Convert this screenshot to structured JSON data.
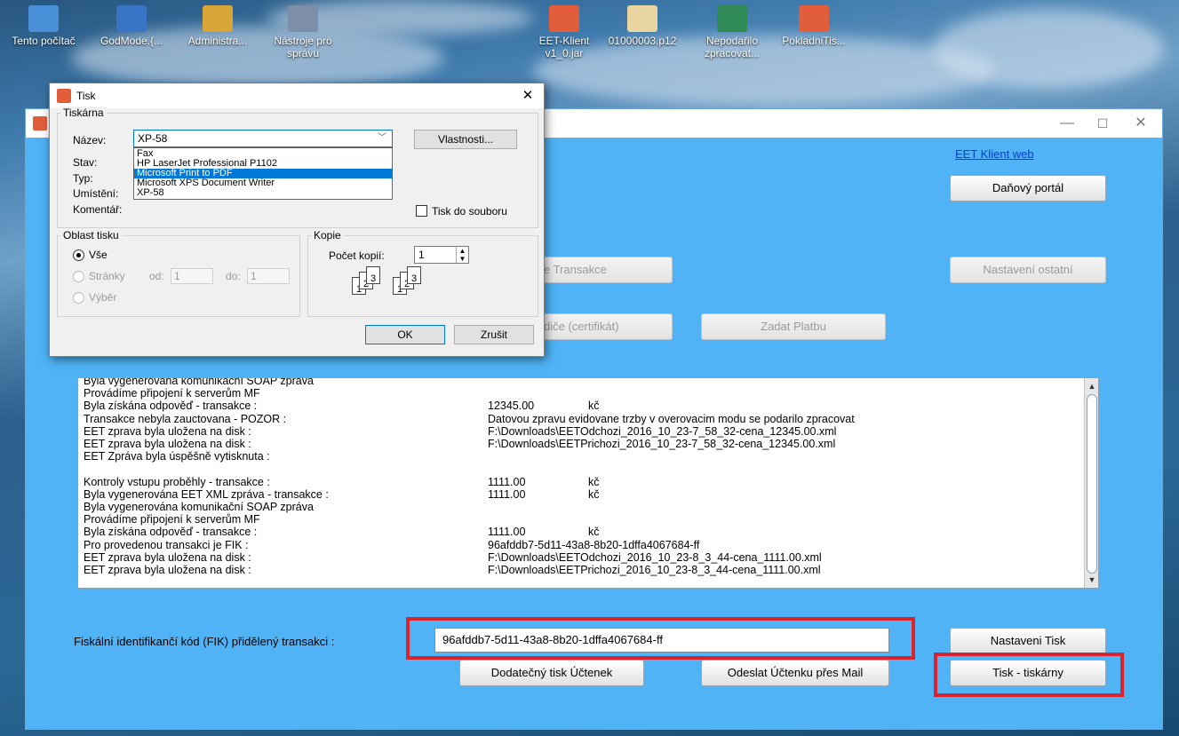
{
  "desktop": {
    "icons": [
      {
        "label": "Tento počítač",
        "icon": "computer-icon",
        "color": "#4a90d9"
      },
      {
        "label": "GodMode.{...",
        "icon": "control-panel-icon",
        "color": "#3a74c4"
      },
      {
        "label": "Administra...",
        "icon": "user-folder-icon",
        "color": "#d8a638"
      },
      {
        "label": "Nástroje pro správu",
        "icon": "admin-tools-icon",
        "color": "#7d8fa8"
      },
      {
        "label": "EET-Klient v1_0.jar",
        "icon": "java-jar-icon",
        "color": "#e25d3a"
      },
      {
        "label": "01000003.p12",
        "icon": "certificate-icon",
        "color": "#e8d5a0"
      },
      {
        "label": "Nepodařilo zpracovat...",
        "icon": "publisher-icon",
        "color": "#2f8a55"
      },
      {
        "label": "PokladniTis...",
        "icon": "java-jar-icon",
        "color": "#e25d3a"
      }
    ]
  },
  "app": {
    "title": "",
    "eet_link": "EET Klient web",
    "buttons": {
      "danovy_portal": "Daňový portál",
      "transakce": "e Transakce",
      "nastaveni_ostatni": "Nastavení ostatní",
      "certifikat": "diče (certifikát)",
      "zadat_platbu": "Zadat Platbu",
      "nastaveni_tisk": "Nastaveni Tisk",
      "dodatecny_tisk": "Dodatečný tisk Účtenek",
      "odeslat_mail": "Odeslat Účtenku přes Mail",
      "tisk_tiskarny": "Tisk - tiskárny"
    },
    "log": [
      {
        "text": "Byla vygenerována komunikační SOAP zpráva",
        "value": "",
        "unit": ""
      },
      {
        "text": "Provádíme připojení k serverům MF",
        "value": "",
        "unit": ""
      },
      {
        "text": "Byla získána odpověď - transakce :",
        "value": "12345.00",
        "unit": "kč"
      },
      {
        "text": "Transakce nebyla zauctovana - POZOR :",
        "value": "Datovou zpravu evidovane trzby v overovacim modu se podarilo zpracovat",
        "unit": ""
      },
      {
        "text": "EET zprava byla uložena na disk :",
        "value": "F:\\Downloads\\EETOdchozi_2016_10_23-7_58_32-cena_12345.00.xml",
        "unit": ""
      },
      {
        "text": "EET zprava byla uložena na disk :",
        "value": "F:\\Downloads\\EETPrichozi_2016_10_23-7_58_32-cena_12345.00.xml",
        "unit": ""
      },
      {
        "text": "EET Zpráva byla úspěšně vytisknuta :",
        "value": "",
        "unit": ""
      },
      {
        "text": "",
        "value": "",
        "unit": ""
      },
      {
        "text": "Kontroly vstupu proběhly - transakce :",
        "value": "1111.00",
        "unit": "kč"
      },
      {
        "text": "Byla vygenerována EET XML zpráva - transakce :",
        "value": "1111.00",
        "unit": "kč"
      },
      {
        "text": "Byla vygenerována komunikační SOAP zpráva",
        "value": "",
        "unit": ""
      },
      {
        "text": "Provádíme připojení k serverům MF",
        "value": "",
        "unit": ""
      },
      {
        "text": "Byla získána odpověď - transakce :",
        "value": "1111.00",
        "unit": "kč"
      },
      {
        "text": "Pro provedenou transakci je FIK :",
        "value": "96afddb7-5d11-43a8-8b20-1dffa4067684-ff",
        "unit": ""
      },
      {
        "text": "EET zprava byla uložena na disk :",
        "value": "F:\\Downloads\\EETOdchozi_2016_10_23-8_3_44-cena_1111.00.xml",
        "unit": ""
      },
      {
        "text": "EET zprava byla uložena na disk :",
        "value": "F:\\Downloads\\EETPrichozi_2016_10_23-8_3_44-cena_1111.00.xml",
        "unit": ""
      }
    ],
    "fik_label": "Fiskální identifikančí kód (FIK) přidělený transakci :",
    "fik_value": "96afddb7-5d11-43a8-8b20-1dffa4067684-ff",
    "highlight_color": "#d9232f",
    "background_color": "#4fb3f5"
  },
  "print_dialog": {
    "title": "Tisk",
    "printer_group": "Tiskárna",
    "name_label": "Název:",
    "selected_printer": "XP-58",
    "properties_button": "Vlastnosti...",
    "status_label": "Stav:",
    "type_label": "Typ:",
    "location_label": "Umístění:",
    "comment_label": "Komentář:",
    "print_to_file": "Tisk do souboru",
    "printer_options": [
      "Fax",
      "HP LaserJet Professional P1102",
      "Microsoft Print to PDF",
      "Microsoft XPS Document Writer",
      "XP-58"
    ],
    "highlighted_option": "Microsoft Print to PDF",
    "range_group": "Oblast tisku",
    "range_all": "Vše",
    "range_pages": "Stránky",
    "from_label": "od:",
    "from_value": "1",
    "to_label": "do:",
    "to_value": "1",
    "range_selection": "Výběr",
    "copies_group": "Kopie",
    "copies_label": "Počet kopií:",
    "copies_value": "1",
    "ok_button": "OK",
    "cancel_button": "Zrušit"
  }
}
